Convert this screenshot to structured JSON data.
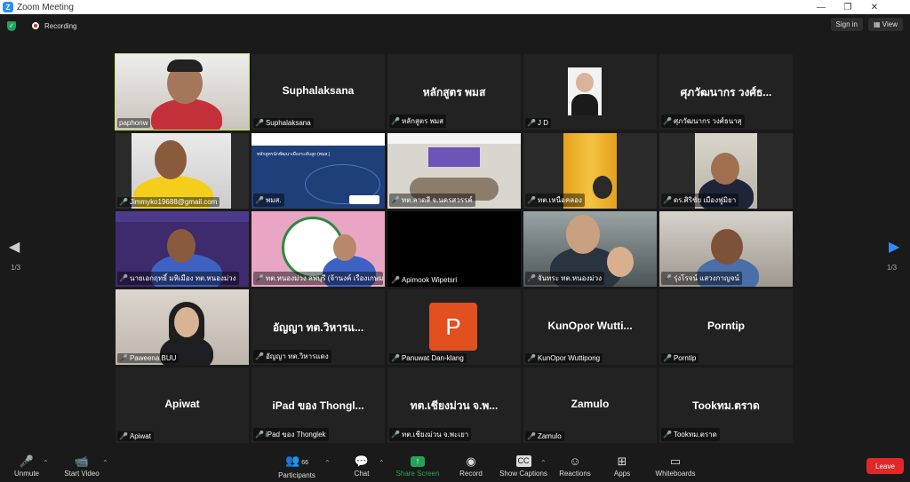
{
  "window": {
    "title": "Zoom Meeting"
  },
  "topbar": {
    "recording": "Recording",
    "sign_in": "Sign in",
    "view": "View"
  },
  "pager": {
    "left": "1/3",
    "right": "1/3"
  },
  "tiles": [
    {
      "label": "paphonw",
      "big": ""
    },
    {
      "label": "Suphalaksana",
      "big": "Suphalaksana"
    },
    {
      "label": "หลักสูตร พมส",
      "big": "หลักสูตร พมส"
    },
    {
      "label": "J D",
      "big": ""
    },
    {
      "label": "ศุภวัฒนากร วงศ์ธนาสุ",
      "big": "ศุภวัฒนากร วงศ์ธ..."
    },
    {
      "label": "Jimmyko19688@gmail.com",
      "big": ""
    },
    {
      "label": "พมส.",
      "big": ""
    },
    {
      "label": "ทต.ลาดสี จ.นครสวรรค์",
      "big": ""
    },
    {
      "label": "ทต.เหนือคลอง",
      "big": ""
    },
    {
      "label": "ดร.ศิริชัย เมืองฟูมิยา",
      "big": ""
    },
    {
      "label": "นายเอกฤทธิ์ มหิเมือง ทต.หนองม่วง",
      "big": ""
    },
    {
      "label": "ทต.หนองม่วง ลพบุรี (จ้านงค์ เรืองเกษม ปลัด...)",
      "big": ""
    },
    {
      "label": "Apimook Wipetsri",
      "big": ""
    },
    {
      "label": "จันทระ ทต.หนองม่วง",
      "big": ""
    },
    {
      "label": "รุ่งโรจน์ แสวงกาญจน์",
      "big": ""
    },
    {
      "label": "Paweena BUU",
      "big": ""
    },
    {
      "label": "อัญญา ทต.วิหารแดง",
      "big": "อัญญา ทต.วิหารแ..."
    },
    {
      "label": "Panuwat Dan-klang",
      "big": "",
      "initial": "P"
    },
    {
      "label": "KunOpor Wuttipong",
      "big": "KunOpor  Wutti..."
    },
    {
      "label": "Porntip",
      "big": "Porntip"
    },
    {
      "label": "Apiwat",
      "big": "Apiwat"
    },
    {
      "label": "iPad ของ Thonglek",
      "big": "iPad ของ Thongl..."
    },
    {
      "label": "ทต.เชียงม่วน จ.พะเยา",
      "big": "ทต.เชียงม่วน จ.พ..."
    },
    {
      "label": "Zamulo",
      "big": "Zamulo"
    },
    {
      "label": "Tookทม.ตราด",
      "big": "Tookทม.ตราด"
    }
  ],
  "slide": {
    "title": "หลักสูตรนักพัฒนาเมืองระดับสูง (พมส.)"
  },
  "toolbar": {
    "unmute": "Unmute",
    "start_video": "Start Video",
    "participants": "Participants",
    "participants_count": "66",
    "chat": "Chat",
    "share_screen": "Share Screen",
    "record": "Record",
    "show_captions": "Show Captions",
    "reactions": "Reactions",
    "apps": "Apps",
    "whiteboards": "Whiteboards",
    "leave": "Leave"
  }
}
